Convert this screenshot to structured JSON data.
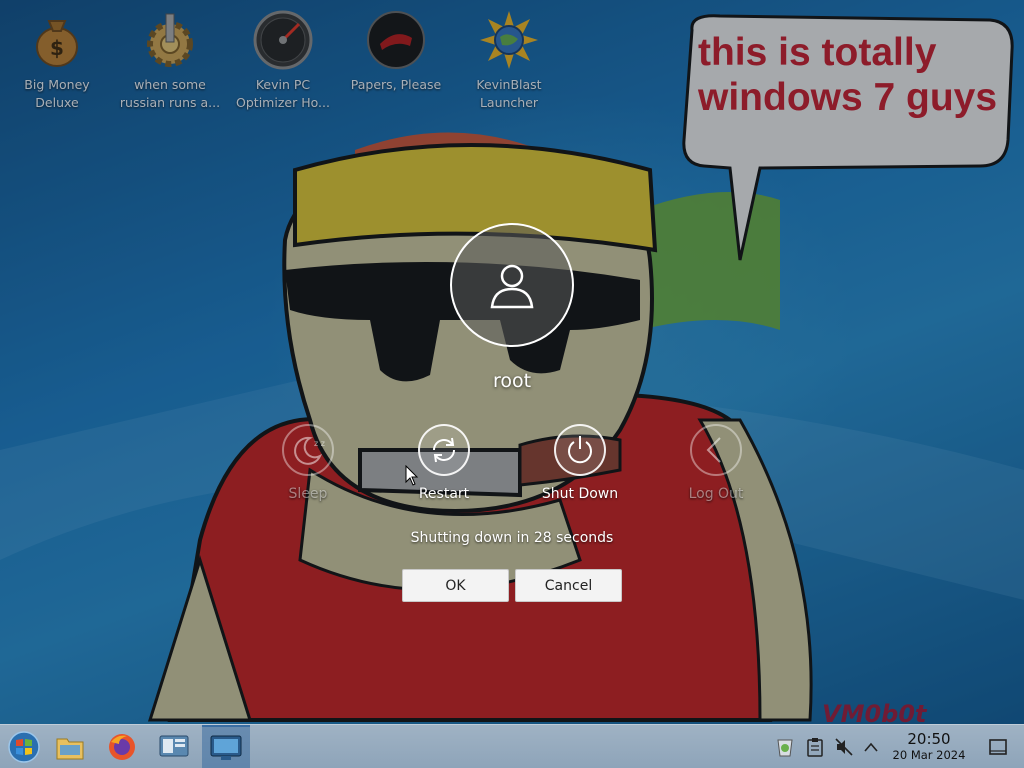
{
  "desktop": {
    "icons": [
      {
        "label_line1": "Big Money",
        "label_line2": "Deluxe",
        "icon": "money-bag-icon"
      },
      {
        "label_line1": "when some",
        "label_line2": "russian runs a...",
        "icon": "gear-icon"
      },
      {
        "label_line1": "Kevin PC",
        "label_line2": "Optimizer Ho...",
        "icon": "speedometer-icon"
      },
      {
        "label_line1": "Papers, Please",
        "label_line2": "",
        "icon": "papers-please-icon"
      },
      {
        "label_line1": "KevinBlast",
        "label_line2": "Launcher",
        "icon": "globe-sun-icon"
      }
    ],
    "wallpaper": {
      "speech_bubble_text_line1": "this is totally",
      "speech_bubble_text_line2": "windows 7 guys",
      "watermark": "VM0b0t"
    }
  },
  "logout_dialog": {
    "username": "root",
    "actions": [
      {
        "label": "Sleep",
        "icon": "sleep-icon",
        "enabled": false
      },
      {
        "label": "Restart",
        "icon": "restart-icon",
        "enabled": true
      },
      {
        "label": "Shut Down",
        "icon": "power-icon",
        "enabled": true
      },
      {
        "label": "Log Out",
        "icon": "log-out-icon",
        "enabled": false
      }
    ],
    "countdown_text": "Shutting down in 28 seconds",
    "ok_label": "OK",
    "cancel_label": "Cancel"
  },
  "taskbar": {
    "items": [
      "start-menu-icon",
      "file-manager-icon",
      "firefox-icon",
      "system-settings-icon",
      "desktop-switcher-icon"
    ],
    "tray": [
      "updates-icon",
      "clipboard-icon",
      "volume-muted-icon",
      "tray-expand-icon"
    ],
    "clock": {
      "time": "20:50",
      "date": "20 Mar 2024"
    },
    "show_desktop": "show-desktop-icon"
  },
  "colors": {
    "bubble_text": "#c21c2c",
    "taskbar": "#9fb2c4",
    "active_task": "#3b6ea3",
    "dialog_button": "#f3f3f3"
  }
}
